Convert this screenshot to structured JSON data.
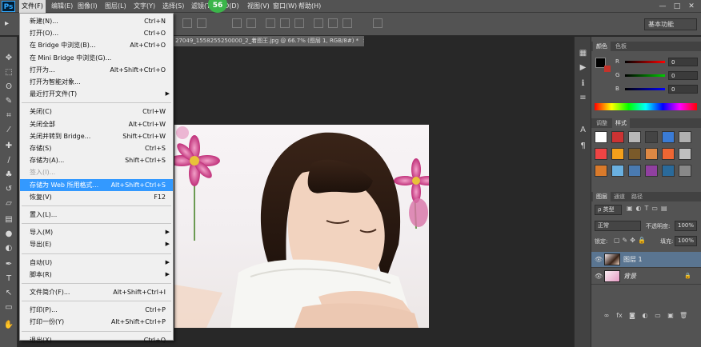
{
  "app": {
    "logo_text": "Ps"
  },
  "menubar": {
    "items": [
      "文件(F)",
      "编辑(E)",
      "图像(I)",
      "图层(L)",
      "文字(Y)",
      "选择(S)",
      "滤镜(T)",
      "3D(D)",
      "视图(V)",
      "窗口(W)",
      "帮助(H)"
    ],
    "active_index": 0,
    "badge": "56",
    "window_controls": [
      "—",
      "□",
      "✕"
    ]
  },
  "options_bar": {
    "workspace": "基本功能"
  },
  "document": {
    "tab_title": "27049_1558255250000_2_着图王.jpg @ 66.7% (图层 1, RGB/8#) *",
    "tab_close": "×"
  },
  "file_menu": [
    {
      "label": "新建(N)...",
      "shortcut": "Ctrl+N"
    },
    {
      "label": "打开(O)...",
      "shortcut": "Ctrl+O"
    },
    {
      "label": "在 Bridge 中浏览(B)...",
      "shortcut": "Alt+Ctrl+O"
    },
    {
      "label": "在 Mini Bridge 中浏览(G)...",
      "shortcut": ""
    },
    {
      "label": "打开为...",
      "shortcut": "Alt+Shift+Ctrl+O"
    },
    {
      "label": "打开为智能对象...",
      "shortcut": ""
    },
    {
      "label": "最近打开文件(T)",
      "shortcut": "",
      "submenu": true
    },
    {
      "sep": true
    },
    {
      "label": "关闭(C)",
      "shortcut": "Ctrl+W"
    },
    {
      "label": "关闭全部",
      "shortcut": "Alt+Ctrl+W"
    },
    {
      "label": "关闭并转到 Bridge...",
      "shortcut": "Shift+Ctrl+W"
    },
    {
      "label": "存储(S)",
      "shortcut": "Ctrl+S"
    },
    {
      "label": "存储为(A)...",
      "shortcut": "Shift+Ctrl+S"
    },
    {
      "label": "签入(I)...",
      "shortcut": "",
      "disabled": true
    },
    {
      "label": "存储为 Web 所用格式...",
      "shortcut": "Alt+Shift+Ctrl+S",
      "highlighted": true
    },
    {
      "label": "恢复(V)",
      "shortcut": "F12"
    },
    {
      "sep": true
    },
    {
      "label": "置入(L)...",
      "shortcut": ""
    },
    {
      "sep": true
    },
    {
      "label": "导入(M)",
      "shortcut": "",
      "submenu": true
    },
    {
      "label": "导出(E)",
      "shortcut": "",
      "submenu": true
    },
    {
      "sep": true
    },
    {
      "label": "自动(U)",
      "shortcut": "",
      "submenu": true
    },
    {
      "label": "脚本(R)",
      "shortcut": "",
      "submenu": true
    },
    {
      "sep": true
    },
    {
      "label": "文件简介(F)...",
      "shortcut": "Alt+Shift+Ctrl+I"
    },
    {
      "sep": true
    },
    {
      "label": "打印(P)...",
      "shortcut": "Ctrl+P"
    },
    {
      "label": "打印一份(Y)",
      "shortcut": "Alt+Shift+Ctrl+P"
    },
    {
      "sep": true
    },
    {
      "label": "退出(X)",
      "shortcut": "Ctrl+Q"
    }
  ],
  "color_panel": {
    "tabs": [
      "颜色",
      "色板"
    ],
    "channels": [
      {
        "label": "R",
        "value": "0"
      },
      {
        "label": "G",
        "value": "0"
      },
      {
        "label": "B",
        "value": "0"
      }
    ],
    "foreground": "#000000",
    "background": "#ffffff"
  },
  "styles_panel": {
    "tabs": [
      "调整",
      "样式"
    ]
  },
  "layers_panel": {
    "tabs": [
      "图层",
      "通道",
      "路径"
    ],
    "filter_label": "ρ 类型",
    "blend_mode": "正常",
    "opacity_label": "不透明度:",
    "opacity_value": "100%",
    "lock_label": "锁定:",
    "fill_label": "填充:",
    "fill_value": "100%",
    "layers": [
      {
        "name": "图层 1",
        "selected": true
      },
      {
        "name": "背景",
        "selected": false
      }
    ],
    "lock_icon": "🔒"
  },
  "colors": {
    "accent_highlight": "#3399ff",
    "layer_selected": "#5a7591",
    "badge_green": "#3bb54a"
  }
}
